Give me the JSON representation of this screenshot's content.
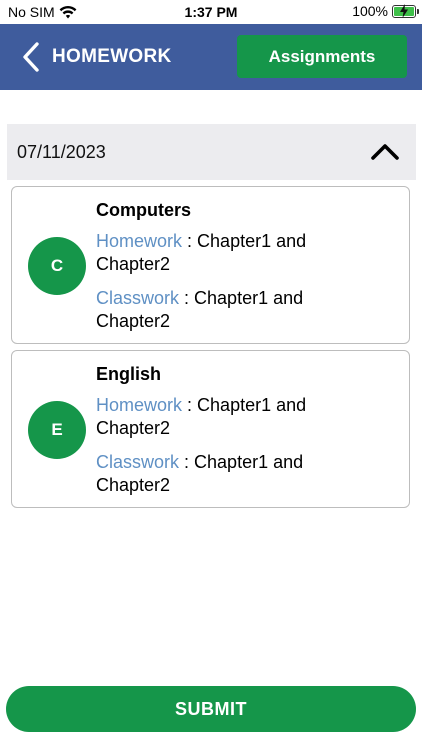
{
  "status_bar": {
    "carrier": "No SIM",
    "time": "1:37 PM",
    "battery": "100%",
    "battery_level": 1.0,
    "icons": [
      "wifi-icon",
      "battery-charging-icon"
    ]
  },
  "header": {
    "title": "HOMEWORK",
    "back_icon": "chevron-left-icon",
    "assignments_label": "Assignments",
    "background": "#3f5c9d",
    "accent": "#15964a"
  },
  "date_group": {
    "date": "07/11/2023",
    "toggle_icon": "chevron-up-icon"
  },
  "subjects": [
    {
      "initial": "C",
      "name": "Computers",
      "homework_label": "Homework",
      "homework_value": "Chapter1 and Chapter2",
      "classwork_label": "Classwork",
      "classwork_value": "Chapter1 and Chapter2"
    },
    {
      "initial": "E",
      "name": "English",
      "homework_label": "Homework",
      "homework_value": "Chapter1 and Chapter2",
      "classwork_label": "Classwork",
      "classwork_value": "Chapter1 and Chapter2"
    }
  ],
  "colors": {
    "label_blue": "#5f90c4",
    "button_green": "#15964a"
  },
  "footer": {
    "submit_label": "SUBMIT"
  }
}
